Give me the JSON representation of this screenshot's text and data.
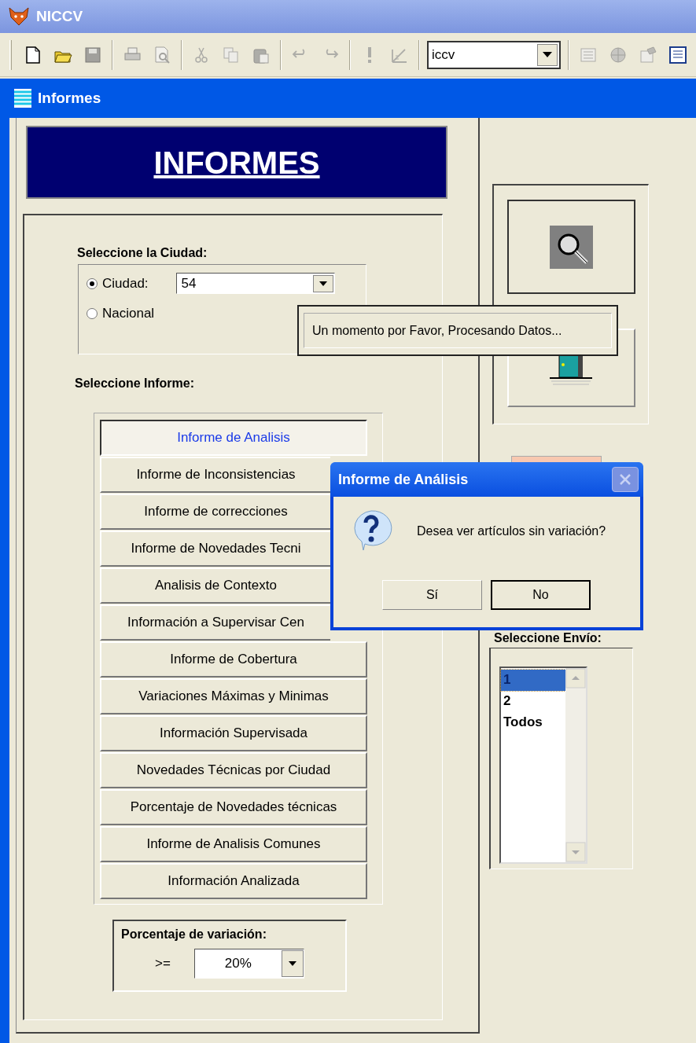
{
  "app_window": {
    "title": "NICCV"
  },
  "toolbar": {
    "tools": [
      {
        "kind": "new",
        "disabled": false
      },
      {
        "kind": "open",
        "disabled": false
      },
      {
        "kind": "save",
        "disabled": true
      },
      {
        "kind": "sep"
      },
      {
        "kind": "print",
        "disabled": true
      },
      {
        "kind": "preview",
        "disabled": true
      },
      {
        "kind": "sep"
      },
      {
        "kind": "cut",
        "disabled": true
      },
      {
        "kind": "copy",
        "disabled": true
      },
      {
        "kind": "paste",
        "disabled": true
      },
      {
        "kind": "sep"
      },
      {
        "kind": "undo",
        "disabled": true
      },
      {
        "kind": "redo",
        "disabled": true
      },
      {
        "kind": "sep"
      },
      {
        "kind": "run",
        "disabled": true
      },
      {
        "kind": "chart",
        "disabled": true
      },
      {
        "kind": "sep"
      },
      {
        "kind": "combo",
        "value": "iccv"
      },
      {
        "kind": "sep"
      },
      {
        "kind": "form",
        "disabled": true
      },
      {
        "kind": "globe",
        "disabled": true
      },
      {
        "kind": "props",
        "disabled": true
      },
      {
        "kind": "window",
        "disabled": false
      }
    ]
  },
  "child_window": {
    "title": "Informes"
  },
  "header": {
    "title": "INFORMES"
  },
  "city_group": {
    "label": "Seleccione la Ciudad:",
    "options": [
      {
        "label": "Ciudad:",
        "selected": true
      },
      {
        "label": "Nacional",
        "selected": false
      }
    ],
    "city_combo": {
      "value": "54"
    }
  },
  "report_group": {
    "label": "Seleccione Informe:",
    "buttons": [
      {
        "label": "Informe de Analisis",
        "highlighted": true
      },
      {
        "label": "Informe de Inconsistencias",
        "highlighted": false
      },
      {
        "label": "Informe de correcciones",
        "highlighted": false
      },
      {
        "label": "Informe de Novedades Tecni",
        "highlighted": false
      },
      {
        "label": "Analisis de Contexto",
        "highlighted": false
      },
      {
        "label": "Información a Supervisar Cen",
        "highlighted": false
      },
      {
        "label": "Informe de Cobertura",
        "highlighted": false
      },
      {
        "label": "Variaciones Máximas y Minimas",
        "highlighted": false
      },
      {
        "label": "Información Supervisada",
        "highlighted": false
      },
      {
        "label": "Novedades Técnicas por Ciudad",
        "highlighted": false
      },
      {
        "label": "Porcentaje de Novedades técnicas",
        "highlighted": false
      },
      {
        "label": "Informe de Analisis Comunes",
        "highlighted": false
      },
      {
        "label": "Información Analizada",
        "highlighted": false
      }
    ]
  },
  "variation": {
    "label": "Porcentaje de variación:",
    "operator": ">=",
    "value": "20%"
  },
  "envio": {
    "label": "Seleccione Envío:",
    "items": [
      {
        "label": "1",
        "selected": true
      },
      {
        "label": "2",
        "selected": false
      },
      {
        "label": "Todos",
        "selected": false
      }
    ]
  },
  "tooltip": {
    "text": "Un momento por Favor, Procesando Datos..."
  },
  "dialog": {
    "title": "Informe de Análisis",
    "message": "Desea ver artículos sin variación?",
    "buttons": [
      {
        "label": "Sí",
        "default": false
      },
      {
        "label": "No",
        "default": true
      }
    ]
  }
}
